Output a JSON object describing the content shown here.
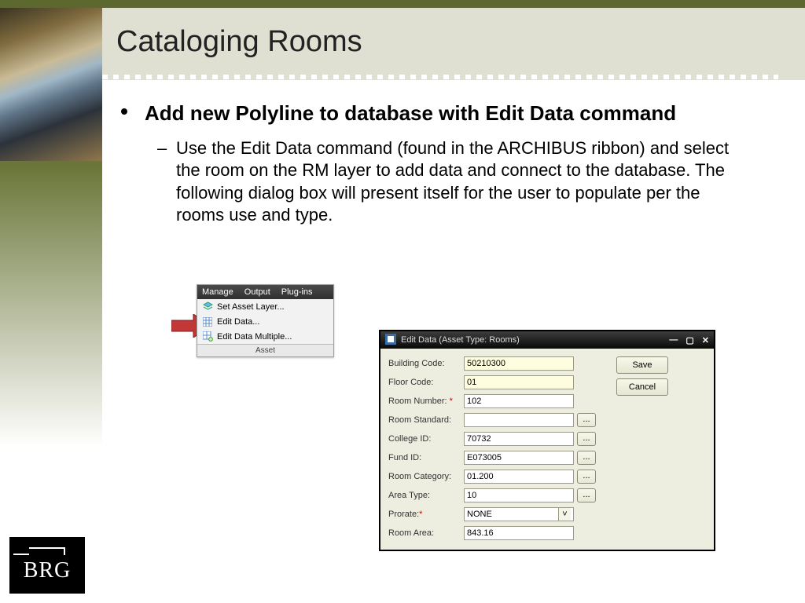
{
  "slide": {
    "title": "Cataloging Rooms",
    "bullet1": "Add new Polyline to database with Edit Data command",
    "bullet2": "Use the Edit Data command (found in the ARCHIBUS ribbon) and select the room on the RM layer to add data and connect to the database. The following dialog box will present itself for the user to populate per the rooms use and type."
  },
  "ribbon": {
    "menus": [
      "Manage",
      "Output",
      "Plug-ins"
    ],
    "items": [
      "Set Asset Layer...",
      "Edit Data...",
      "Edit Data Multiple..."
    ],
    "footer": "Asset"
  },
  "dialog": {
    "title": "Edit Data (Asset Type: Rooms)",
    "buttons": {
      "save": "Save",
      "cancel": "Cancel"
    },
    "fields": {
      "building_code": {
        "label": "Building Code:",
        "value": "50210300",
        "yellow": true,
        "dots": false
      },
      "floor_code": {
        "label": "Floor Code:",
        "value": "01",
        "yellow": true,
        "dots": false
      },
      "room_number": {
        "label": "Room Number:",
        "value": "102",
        "required": true,
        "dots": false
      },
      "room_standard": {
        "label": "Room Standard:",
        "value": "",
        "dots": true
      },
      "college_id": {
        "label": "College ID:",
        "value": "70732",
        "dots": true
      },
      "fund_id": {
        "label": "Fund ID:",
        "value": "E073005",
        "dots": true
      },
      "room_category": {
        "label": "Room  Category:",
        "value": "01.200",
        "dots": true
      },
      "area_type": {
        "label": "Area Type:",
        "value": "10",
        "dots": true
      },
      "prorate": {
        "label": "Prorate:",
        "value": "NONE",
        "required": true,
        "select": true
      },
      "room_area": {
        "label": "Room Area:",
        "value": "843.16",
        "dots": false
      }
    }
  },
  "logo": {
    "text": "BRG"
  }
}
